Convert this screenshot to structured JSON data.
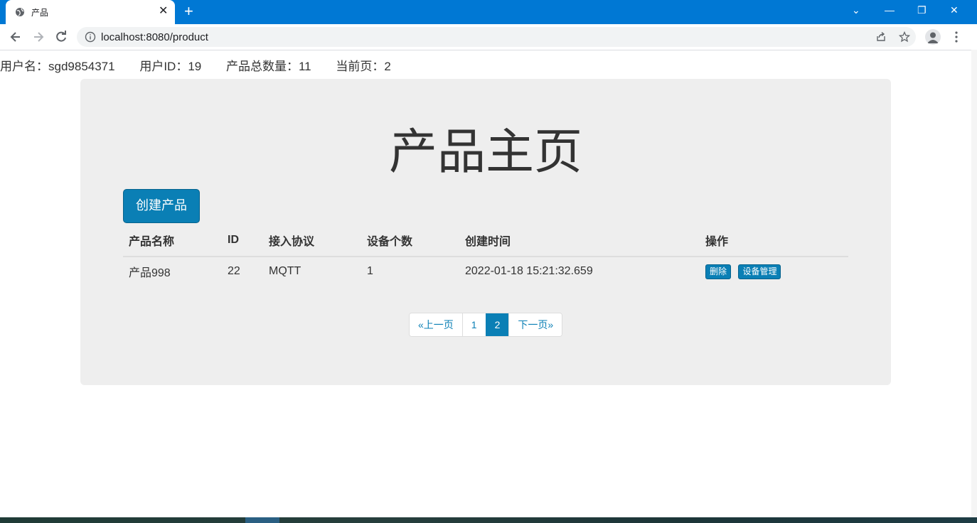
{
  "browser": {
    "tab_title": "产品",
    "url": "localhost:8080/product",
    "new_tab_glyph": "+",
    "close_glyph": "✕",
    "window_controls": [
      "⌄",
      "—",
      "❐",
      "✕"
    ],
    "icons": [
      "globe-icon",
      "back-icon",
      "forward-icon",
      "reload-icon",
      "info-icon",
      "share-icon",
      "star-icon",
      "profile-icon",
      "menu-icon"
    ]
  },
  "userbar": {
    "username": "用户名：sgd9854371",
    "user_id": "用户ID：19",
    "product_count": "产品总数量：11",
    "current_page": "当前页：2"
  },
  "main": {
    "title": "产品主页",
    "create_button": "创建产品"
  },
  "table": {
    "headers": [
      "产品名称",
      "ID",
      "接入协议",
      "设备个数",
      "创建时间",
      "操作"
    ],
    "rows": [
      {
        "name": "产品998",
        "id": "22",
        "protocol": "MQTT",
        "device_count": "1",
        "created": "2022-01-18 15:21:32.659",
        "delete_label": "删除",
        "manage_label": "设备管理"
      }
    ]
  },
  "pagination": {
    "prev": "«上一页",
    "pages": [
      "1",
      "2"
    ],
    "active": "2",
    "next": "下一页»"
  },
  "colors": {
    "tabbar": "#0078d4",
    "accent": "#0a7fb5",
    "jumbotron": "#eeeeee"
  }
}
